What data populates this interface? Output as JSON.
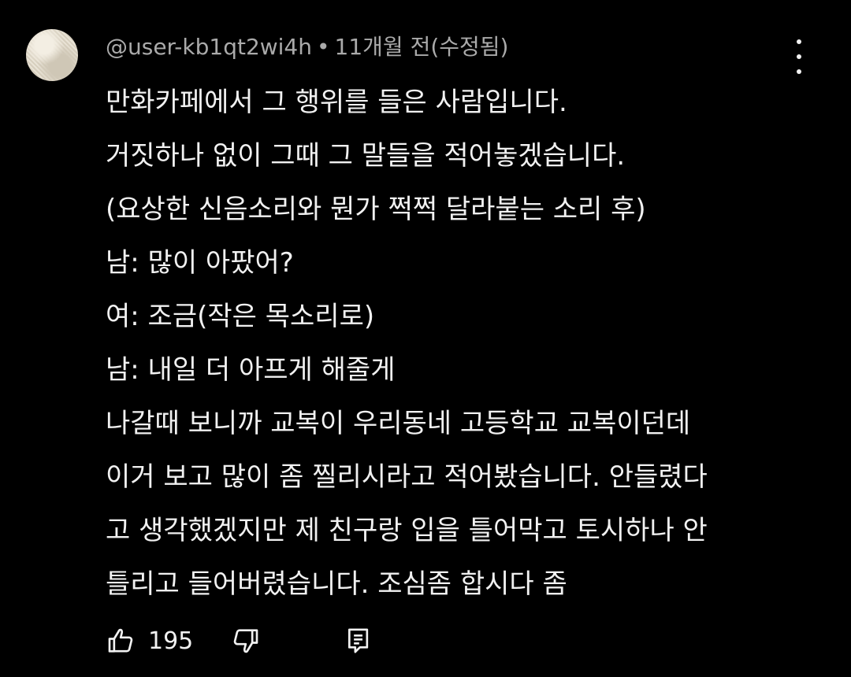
{
  "comment": {
    "author": "@user-kb1qt2wi4h",
    "separator": "•",
    "timestamp": "11개월 전(수정됨)",
    "lines": [
      "만화카페에서 그 행위를 들은 사람입니다.",
      "거짓하나 없이 그때 그 말들을 적어놓겠습니다.",
      "(요상한 신음소리와 뭔가 쩍쩍 달라붙는 소리 후)",
      "남: 많이 아팠어?",
      "여: 조금(작은 목소리로)",
      "남: 내일 더 아프게 해줄게",
      "나갈때 보니까 교복이 우리동네 고등학교 교복이던데",
      "이거 보고 많이 좀 찔리시라고 적어봤습니다. 안들렸다",
      "고 생각했겠지만 제 친구랑 입을 틀어막고 토시하나 안",
      "틀리고 들어버렸습니다. 조심좀 합시다 좀"
    ],
    "like_count": "195",
    "icons": {
      "menu": "more-vert-icon",
      "like": "thumbs-up-icon",
      "dislike": "thumbs-down-icon",
      "reply": "reply-comment-icon"
    },
    "colors": {
      "background": "#000000",
      "text": "#f1f1f1",
      "meta": "#aaaaaa"
    }
  }
}
